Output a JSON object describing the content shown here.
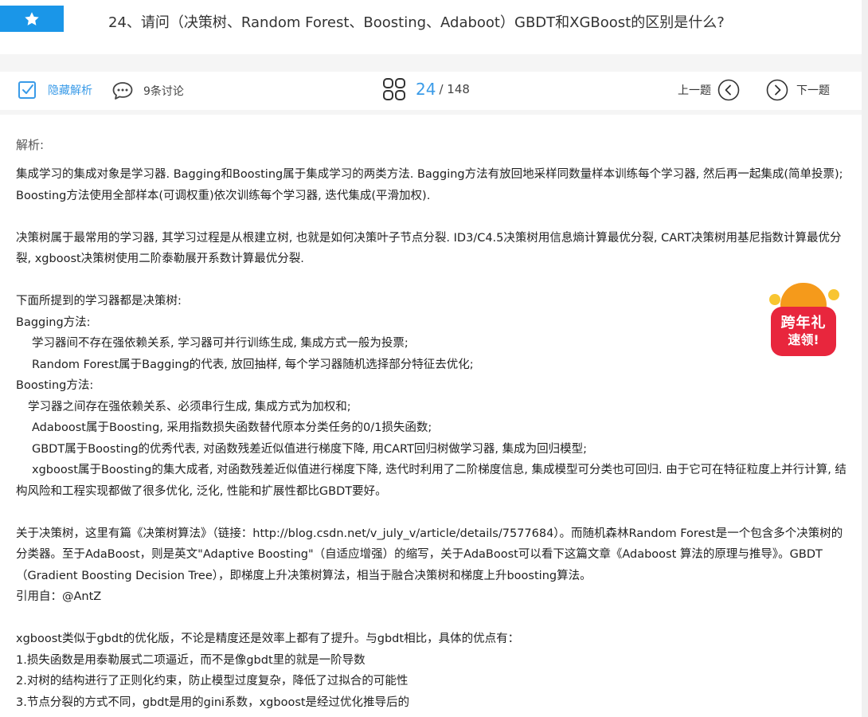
{
  "header": {
    "title": "24、请问（决策树、Random Forest、Boosting、Adaboot）GBDT和XGBoost的区别是什么?"
  },
  "toolbar": {
    "hide_analysis": "隐藏解析",
    "discussion": "9条讨论",
    "current": "24",
    "total": "/ 148",
    "prev": "上一题",
    "next": "下一题"
  },
  "content": {
    "label": "解析:",
    "lines": [
      "集成学习的集成对象是学习器. Bagging和Boosting属于集成学习的两类方法. Bagging方法有放回地采样同数量样本训练每个学习器, 然后再一起集成(简单投票); Boosting方法使用全部样本(可调权重)依次训练每个学习器, 迭代集成(平滑加权).",
      "决策树属于最常用的学习器, 其学习过程是从根建立树, 也就是如何决策叶子节点分裂. ID3/C4.5决策树用信息熵计算最优分裂, CART决策树用基尼指数计算最优分裂, xgboost决策树使用二阶泰勒展开系数计算最优分裂.",
      "下面所提到的学习器都是决策树:",
      "Bagging方法:",
      "学习器间不存在强依赖关系, 学习器可并行训练生成, 集成方式一般为投票;",
      "Random Forest属于Bagging的代表, 放回抽样, 每个学习器随机选择部分特征去优化;",
      "Boosting方法:",
      "学习器之间存在强依赖关系、必须串行生成, 集成方式为加权和;",
      "Adaboost属于Boosting, 采用指数损失函数替代原本分类任务的0/1损失函数;",
      "GBDT属于Boosting的优秀代表, 对函数残差近似值进行梯度下降, 用CART回归树做学习器, 集成为回归模型;",
      "xgboost属于Boosting的集大成者, 对函数残差近似值进行梯度下降, 迭代时利用了二阶梯度信息, 集成模型可分类也可回归. 由于它可在特征粒度上并行计算, 结构风险和工程实现都做了很多优化, 泛化, 性能和扩展性都比GBDT要好。",
      "关于决策树，这里有篇《决策树算法》（链接：http://blog.csdn.net/v_july_v/article/details/7577684）。而随机森林Random Forest是一个包含多个决策树的分类器。至于AdaBoost，则是英文\"Adaptive Boosting\"（自适应增强）的缩写，关于AdaBoost可以看下这篇文章《Adaboost 算法的原理与推导》。GBDT（Gradient Boosting Decision Tree），即梯度上升决策树算法，相当于融合决策树和梯度上升boosting算法。",
      "引用自：@AntZ",
      "xgboost类似于gbdt的优化版，不论是精度还是效率上都有了提升。与gbdt相比，具体的优点有：",
      "1.损失函数是用泰勒展式二项逼近，而不是像gbdt里的就是一阶导数",
      "2.对树的结构进行了正则化约束，防止模型过度复杂，降低了过拟合的可能性",
      "3.节点分裂的方式不同，gbdt是用的gini系数，xgboost是经过优化推导后的"
    ]
  },
  "promo": {
    "line1": "跨年礼",
    "line2": "速领!"
  },
  "colors": {
    "accent": "#1a96e8",
    "link": "#3a9be8",
    "promo": "#e8263d"
  }
}
